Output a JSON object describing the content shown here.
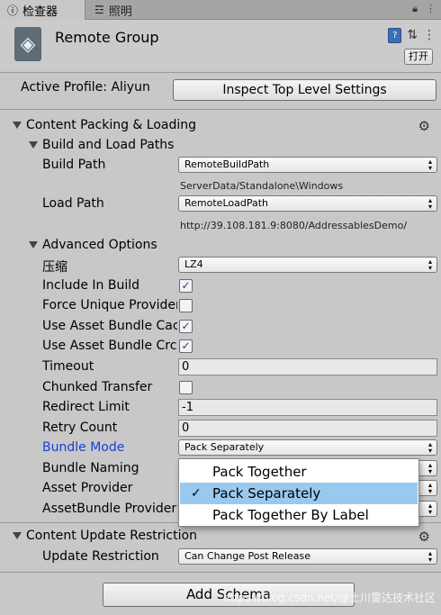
{
  "tabs": {
    "inspector": "检查器",
    "lighting": "照明"
  },
  "object": {
    "name": "Remote Group",
    "open_label": "打开"
  },
  "profile": {
    "label": "Active Profile: Aliyun",
    "inspect_button": "Inspect Top Level Settings"
  },
  "packing": {
    "title": "Content Packing & Loading",
    "build_load": {
      "title": "Build and Load Paths",
      "build_path_label": "Build Path",
      "build_path_value": "RemoteBuildPath",
      "build_path_resolved": "ServerData/Standalone\\Windows",
      "load_path_label": "Load Path",
      "load_path_value": "RemoteLoadPath",
      "load_path_resolved": "http://39.108.181.9:8080/AddressablesDemo/"
    },
    "advanced": {
      "title": "Advanced Options",
      "compression_label": "压缩",
      "compression_value": "LZ4",
      "include_in_build": "Include In Build",
      "force_unique": "Force Unique Provider",
      "use_cache": "Use Asset Bundle Cach",
      "use_crc": "Use Asset Bundle Crc",
      "timeout_label": "Timeout",
      "timeout_value": "0",
      "chunked_label": "Chunked Transfer",
      "redirect_label": "Redirect Limit",
      "redirect_value": "-1",
      "retry_label": "Retry Count",
      "retry_value": "0",
      "bundle_mode_label": "Bundle Mode",
      "bundle_mode_value": "Pack Separately",
      "bundle_naming_label": "Bundle Naming",
      "asset_provider_label": "Asset Provider",
      "assetbundle_provider_label": "AssetBundle Provider",
      "include_in_build_checked": true,
      "force_unique_checked": false,
      "use_cache_checked": true,
      "use_crc_checked": true,
      "chunked_checked": false
    }
  },
  "bundle_mode_menu": {
    "options": [
      "Pack Together",
      "Pack Separately",
      "Pack Together By Label"
    ],
    "selected": "Pack Separately"
  },
  "update": {
    "title": "Content Update Restriction",
    "restriction_label": "Update Restriction",
    "restriction_value": "Can Change Post Release"
  },
  "add_schema": "Add Schema",
  "watermark": "https://blog.csdn.net/@土川雷达技术社区"
}
